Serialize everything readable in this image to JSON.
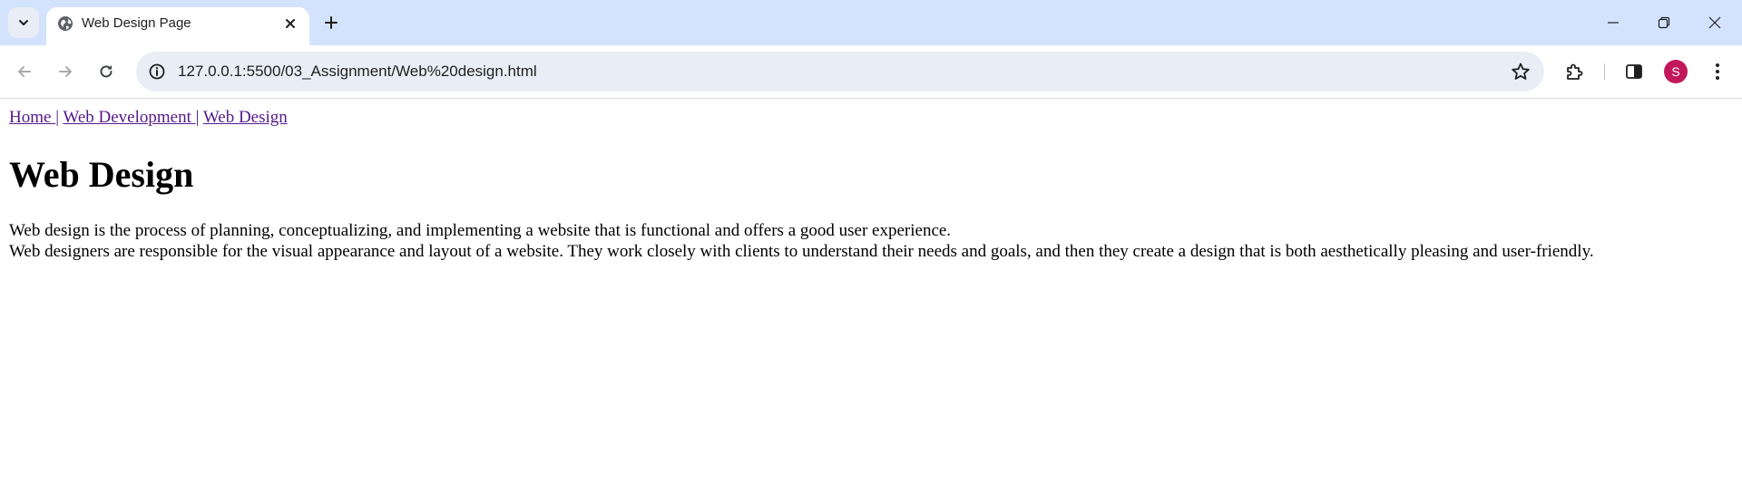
{
  "browser": {
    "tab": {
      "title": "Web Design Page"
    },
    "address_bar": {
      "url": "127.0.0.1:5500/03_Assignment/Web%20design.html"
    },
    "profile": {
      "initial": "S",
      "color": "#c2185b"
    },
    "colors": {
      "tabstrip": "#d3e3fd",
      "omnibox": "#e9eef6",
      "visited_link": "#551a8b"
    },
    "icons": {
      "tab_search": "chevron-down-icon",
      "favicon": "globe-icon",
      "tab_close": "close-icon",
      "new_tab": "plus-icon",
      "back": "arrow-left-icon",
      "forward": "arrow-right-icon",
      "reload": "reload-icon",
      "site_info": "info-icon",
      "bookmark": "star-icon",
      "extensions": "puzzle-icon",
      "side_panel": "side-panel-icon",
      "menu": "kebab-menu-icon",
      "minimize": "minimize-icon",
      "restore": "restore-icon",
      "close_window": "close-window-icon"
    }
  },
  "page": {
    "nav": {
      "home": "Home ",
      "web_development": "Web Development ",
      "web_design": "Web Design",
      "separator": "|"
    },
    "heading": "Web Design",
    "paragraph_line1": "Web design is the process of planning, conceptualizing, and implementing a website that is functional and offers a good user experience.",
    "paragraph_line2": "Web designers are responsible for the visual appearance and layout of a website. They work closely with clients to understand their needs and goals, and then they create a design that is both aesthetically pleasing and user-friendly."
  }
}
